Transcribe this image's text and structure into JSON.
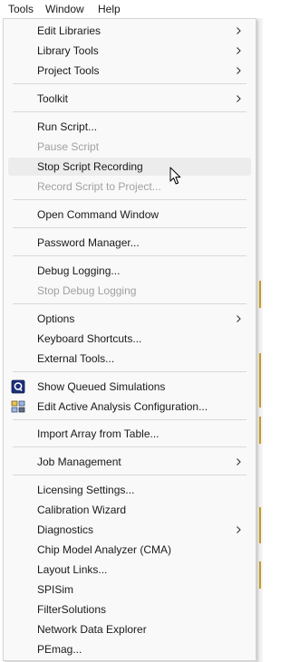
{
  "menubar": {
    "items": [
      "Tools",
      "Window",
      "Help"
    ]
  },
  "menu": {
    "items": [
      {
        "label": "Edit Libraries",
        "submenu": true
      },
      {
        "label": "Library Tools",
        "submenu": true
      },
      {
        "label": "Project Tools",
        "submenu": true
      },
      {
        "label": "Toolkit",
        "submenu": true
      },
      {
        "label": "Run Script..."
      },
      {
        "label": "Pause Script",
        "disabled": true
      },
      {
        "label": "Stop Script Recording",
        "highlighted": true
      },
      {
        "label": "Record Script to Project...",
        "disabled": true
      },
      {
        "label": "Open Command Window"
      },
      {
        "label": "Password Manager..."
      },
      {
        "label": "Debug Logging..."
      },
      {
        "label": "Stop Debug Logging",
        "disabled": true
      },
      {
        "label": "Options",
        "submenu": true
      },
      {
        "label": "Keyboard Shortcuts..."
      },
      {
        "label": "External Tools..."
      },
      {
        "label": "Show Queued Simulations",
        "icon": "queued-simulations-icon"
      },
      {
        "label": "Edit Active Analysis Configuration...",
        "icon": "analysis-configuration-icon"
      },
      {
        "label": "Import Array from Table..."
      },
      {
        "label": "Job Management",
        "submenu": true
      },
      {
        "label": "Licensing Settings..."
      },
      {
        "label": "Calibration Wizard"
      },
      {
        "label": "Diagnostics",
        "submenu": true
      },
      {
        "label": "Chip Model Analyzer (CMA)"
      },
      {
        "label": "Layout Links..."
      },
      {
        "label": "SPISim"
      },
      {
        "label": "FilterSolutions"
      },
      {
        "label": "Network Data Explorer"
      },
      {
        "label": "PEmag..."
      }
    ]
  },
  "colors": {
    "menu_bg": "#f9f9f9",
    "hover_bg": "#ececec",
    "disabled_text": "#a0a0a0",
    "separator": "#d9d9d9"
  }
}
